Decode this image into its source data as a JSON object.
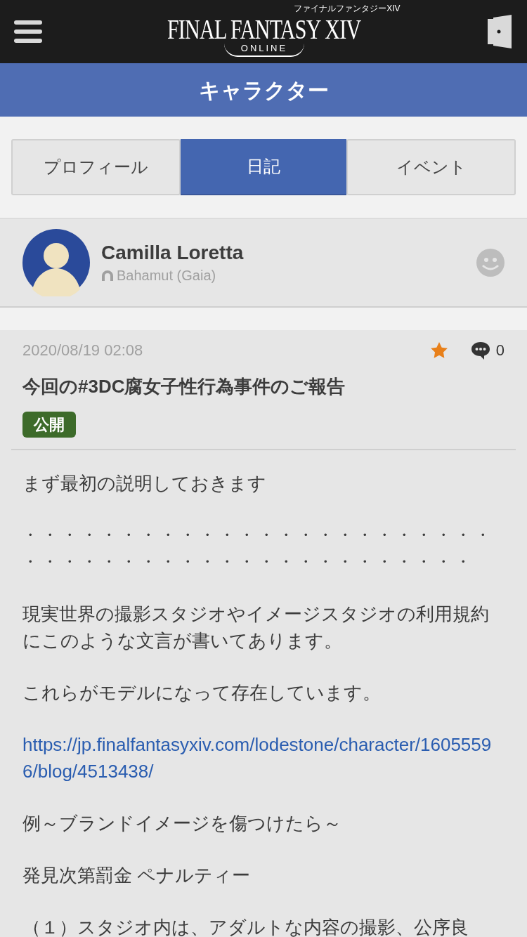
{
  "header": {
    "logo": {
      "title": "FINAL FANTASY XIV",
      "subtitle": "ONLINE",
      "kana": "ファイナルファンタジーXIV"
    }
  },
  "page_title": "キャラクター",
  "tabs": [
    {
      "label": "プロフィール",
      "selected": false
    },
    {
      "label": "日記",
      "selected": true
    },
    {
      "label": "イベント",
      "selected": false
    }
  ],
  "character": {
    "name": "Camilla Loretta",
    "world": "Bahamut (Gaia)"
  },
  "post": {
    "date": "2020/08/19 02:08",
    "comments": "0",
    "title": "今回の#3DC腐女子性行為事件のご報告",
    "visibility": "公開",
    "body": [
      {
        "kind": "text",
        "text": "まず最初の説明しておきます"
      },
      {
        "kind": "lines",
        "lines": [
          "・・・・・・・・・・・・・・・・・・・・・・・・",
          "・・・・・・・・・・・・・・・・・・・・・・・"
        ]
      },
      {
        "kind": "text",
        "text": "現実世界の撮影スタジオやイメージスタジオの利用規約にこのような文言が書いてあります。"
      },
      {
        "kind": "text",
        "text": "これらがモデルになって存在しています。"
      },
      {
        "kind": "link",
        "text": "https://jp.finalfantasyxiv.com/lodestone/character/16055596/blog/4513438/"
      },
      {
        "kind": "text",
        "text": "例～ブランドイメージを傷つけたら～"
      },
      {
        "kind": "text",
        "text": "発見次第罰金 ペナルティー"
      },
      {
        "kind": "text",
        "text": "（１）スタジオ内は、アダルトな内容の撮影、公序良"
      }
    ]
  }
}
